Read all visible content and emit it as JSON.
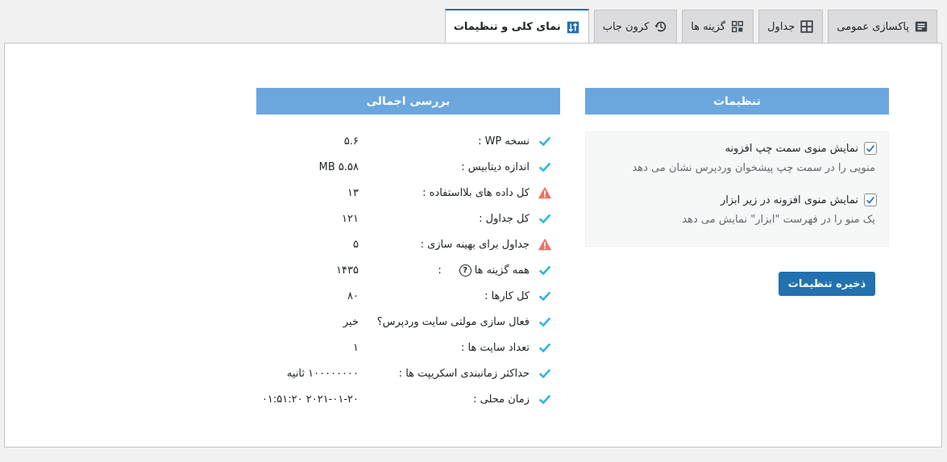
{
  "tabs": [
    {
      "label": "پاکسازی عمومی",
      "icon": "notes-icon",
      "active": false
    },
    {
      "label": "جداول",
      "icon": "table-icon",
      "active": false
    },
    {
      "label": "گزینه ها",
      "icon": "options-grid-icon",
      "active": false
    },
    {
      "label": "کرون جاب",
      "icon": "history-icon",
      "active": false
    },
    {
      "label": "نمای کلی و تنظیمات",
      "icon": "sort-icon",
      "active": true
    }
  ],
  "settings": {
    "title": "تنظیمات",
    "options": [
      {
        "label": "نمایش منوی سمت چپ افزونه",
        "description": "منویی را در سمت چپ پیشخوان وردپرس نشان می دهد",
        "checked": true
      },
      {
        "label": "نمایش منوی افزونه در زیر ابزار",
        "description": "یک منو را در فهرست \"ابزار\" نمایش می دهد",
        "checked": true
      }
    ],
    "save_label": "ذخیره تنظیمات"
  },
  "overview": {
    "title": "بررسی اجمالی",
    "stats": [
      {
        "label": "نسخه WP :",
        "value": "۵.۶",
        "status": "ok"
      },
      {
        "label": "اندازه دیتابیس :",
        "value": "MB ۵.۵۸",
        "status": "ok"
      },
      {
        "label": "کل داده های بلااستفاده :",
        "value": "۱۳",
        "status": "warning"
      },
      {
        "label": "کل جداول :",
        "value": "۱۲۱",
        "status": "ok"
      },
      {
        "label": "جداول برای بهینه سازی :",
        "value": "۵",
        "status": "warning"
      },
      {
        "label": "همه گزینه ها",
        "label_suffix": ":",
        "help": "?",
        "value": "۱۴۳۵",
        "status": "ok"
      },
      {
        "label": "کل کارها :",
        "value": "۸۰",
        "status": "ok"
      },
      {
        "label": "فعال سازی مولتی سایت وردپرس؟",
        "value": "خیر",
        "status": "ok"
      },
      {
        "label": "تعداد سایت ها :",
        "value": "۱",
        "status": "ok"
      },
      {
        "label": "حداکثر زمانبندی اسکریپت ها :",
        "value": "۱۰۰۰۰۰۰۰۰ ثانیه",
        "status": "ok"
      },
      {
        "label": "زمان محلی :",
        "value": "۲۰۲۱-۰۱-۲۰ ۰۱:۵۱:۲۰",
        "status": "ok"
      }
    ]
  },
  "colors": {
    "accent": "#2271b1",
    "header": "#6ba7dd",
    "check": "#2fb3e6",
    "warning": "#ef7064"
  }
}
